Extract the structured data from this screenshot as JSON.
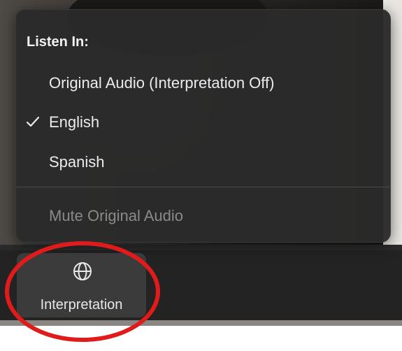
{
  "menu": {
    "header": "Listen In:",
    "items": [
      {
        "label": "Original Audio (Interpretation Off)",
        "checked": false,
        "enabled": true
      },
      {
        "label": "English",
        "checked": true,
        "enabled": true
      },
      {
        "label": "Spanish",
        "checked": false,
        "enabled": true
      }
    ],
    "mute_label": "Mute Original Audio",
    "mute_enabled": false
  },
  "toolbar": {
    "interpretation_label": "Interpretation",
    "interpretation_icon": "globe-icon"
  },
  "colors": {
    "menu_background": "#2a2a2a",
    "toolbar_background": "#232323",
    "button_background": "#3b3b3b",
    "annotation": "#e01b1b",
    "disabled_text": "#8a8a8a"
  }
}
